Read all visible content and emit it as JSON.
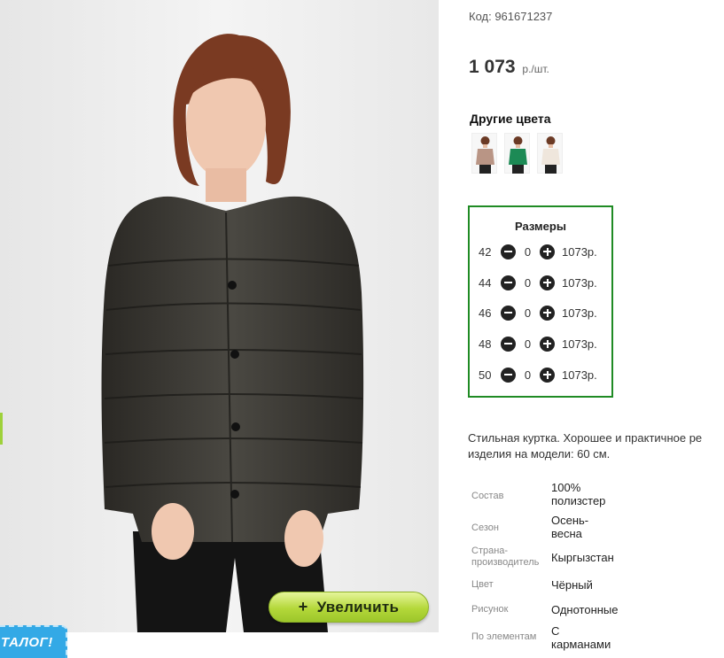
{
  "product": {
    "code_line": "Код: 961671237",
    "price_value": "1 073",
    "price_unit": "р./шт.",
    "zoom_plus": "+",
    "zoom_label": "Увеличить",
    "catalog_badge": "ТАЛОГ!"
  },
  "other_colors": {
    "title": "Другие цвета",
    "swatches": [
      "beige-blouse",
      "green-blouse",
      "white-blouse"
    ]
  },
  "sizes": {
    "title": "Размеры",
    "rows": [
      {
        "size": "42",
        "qty": "0",
        "price": "1073р."
      },
      {
        "size": "44",
        "qty": "0",
        "price": "1073р."
      },
      {
        "size": "46",
        "qty": "0",
        "price": "1073р."
      },
      {
        "size": "48",
        "qty": "0",
        "price": "1073р."
      },
      {
        "size": "50",
        "qty": "0",
        "price": "1073р."
      }
    ]
  },
  "description": {
    "line1": "Стильная куртка. Хорошее и практичное ре",
    "line2": "изделия на модели: 60 см."
  },
  "properties": [
    {
      "key1": "Состав",
      "key2": "",
      "val1": "100%",
      "val2": "полизстер"
    },
    {
      "key1": "Сезон",
      "key2": "",
      "val1": "Осень-",
      "val2": "весна"
    },
    {
      "key1": "Страна-",
      "key2": "производитель",
      "val1": "Кыргызстан",
      "val2": ""
    },
    {
      "key1": "Цвет",
      "key2": "",
      "val1": "Чёрный",
      "val2": ""
    },
    {
      "key1": "Рисунок",
      "key2": "",
      "val1": "Однотонные",
      "val2": ""
    },
    {
      "key1": "По элементам",
      "key2": "",
      "val1": "С",
      "val2": "карманами"
    }
  ],
  "colors": {
    "accent_green": "#1f8b24",
    "zoom_button": "#b4d83a",
    "catalog_blue": "#33a9e6"
  }
}
